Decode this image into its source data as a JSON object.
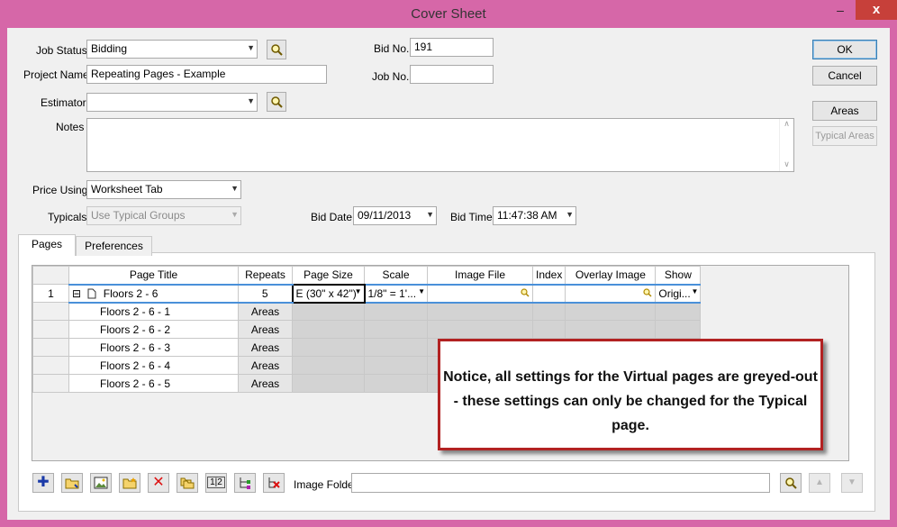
{
  "window": {
    "title": "Cover Sheet",
    "minimize": "–",
    "close": "x"
  },
  "form": {
    "job_status_label": "Job Status",
    "job_status_value": "Bidding",
    "project_name_label": "Project Name",
    "project_name_value": "Repeating Pages - Example",
    "estimator_label": "Estimator",
    "estimator_value": "",
    "notes_label": "Notes",
    "notes_value": "",
    "bid_no_label": "Bid No.",
    "bid_no_value": "191",
    "job_no_label": "Job No.",
    "job_no_value": "",
    "price_using_label": "Price Using",
    "price_using_value": "Worksheet Tab",
    "typicals_label": "Typicals",
    "typicals_value": "Use Typical Groups",
    "bid_date_label": "Bid Date",
    "bid_date_value": "09/11/2013",
    "bid_time_label": "Bid Time",
    "bid_time_value": "11:47:38 AM"
  },
  "buttons": {
    "ok": "OK",
    "cancel": "Cancel",
    "areas": "Areas",
    "typical_areas": "Typical Areas"
  },
  "tabs": [
    {
      "label": "Pages"
    },
    {
      "label": "Preferences"
    }
  ],
  "grid": {
    "columns": [
      "Page Title",
      "Repeats",
      "Page Size",
      "Scale",
      "Image File",
      "Index",
      "Overlay Image",
      "Show"
    ],
    "typical_row": {
      "num": "1",
      "expander": "⊟",
      "title": "Floors 2 - 6",
      "repeats": "5",
      "page_size": "E (30\" x 42\")",
      "scale": "1/8\" = 1'...",
      "show": "Origi..."
    },
    "virtual_rows": [
      {
        "title": "Floors 2 - 6 - 1",
        "areas": "Areas"
      },
      {
        "title": "Floors 2 - 6 - 2",
        "areas": "Areas"
      },
      {
        "title": "Floors 2 - 6 - 3",
        "areas": "Areas"
      },
      {
        "title": "Floors 2 - 6 - 4",
        "areas": "Areas"
      },
      {
        "title": "Floors 2 - 6 - 5",
        "areas": "Areas"
      }
    ]
  },
  "callout": {
    "text": "Notice, all settings for the Virtual pages are greyed-out - these settings can only be changed for the Typical page."
  },
  "footer": {
    "image_folder_label": "Image Folder",
    "image_folder_value": ""
  },
  "icons": {
    "search": "magnifier-icon",
    "add": "plus-icon",
    "delete": "red-x-icon"
  }
}
